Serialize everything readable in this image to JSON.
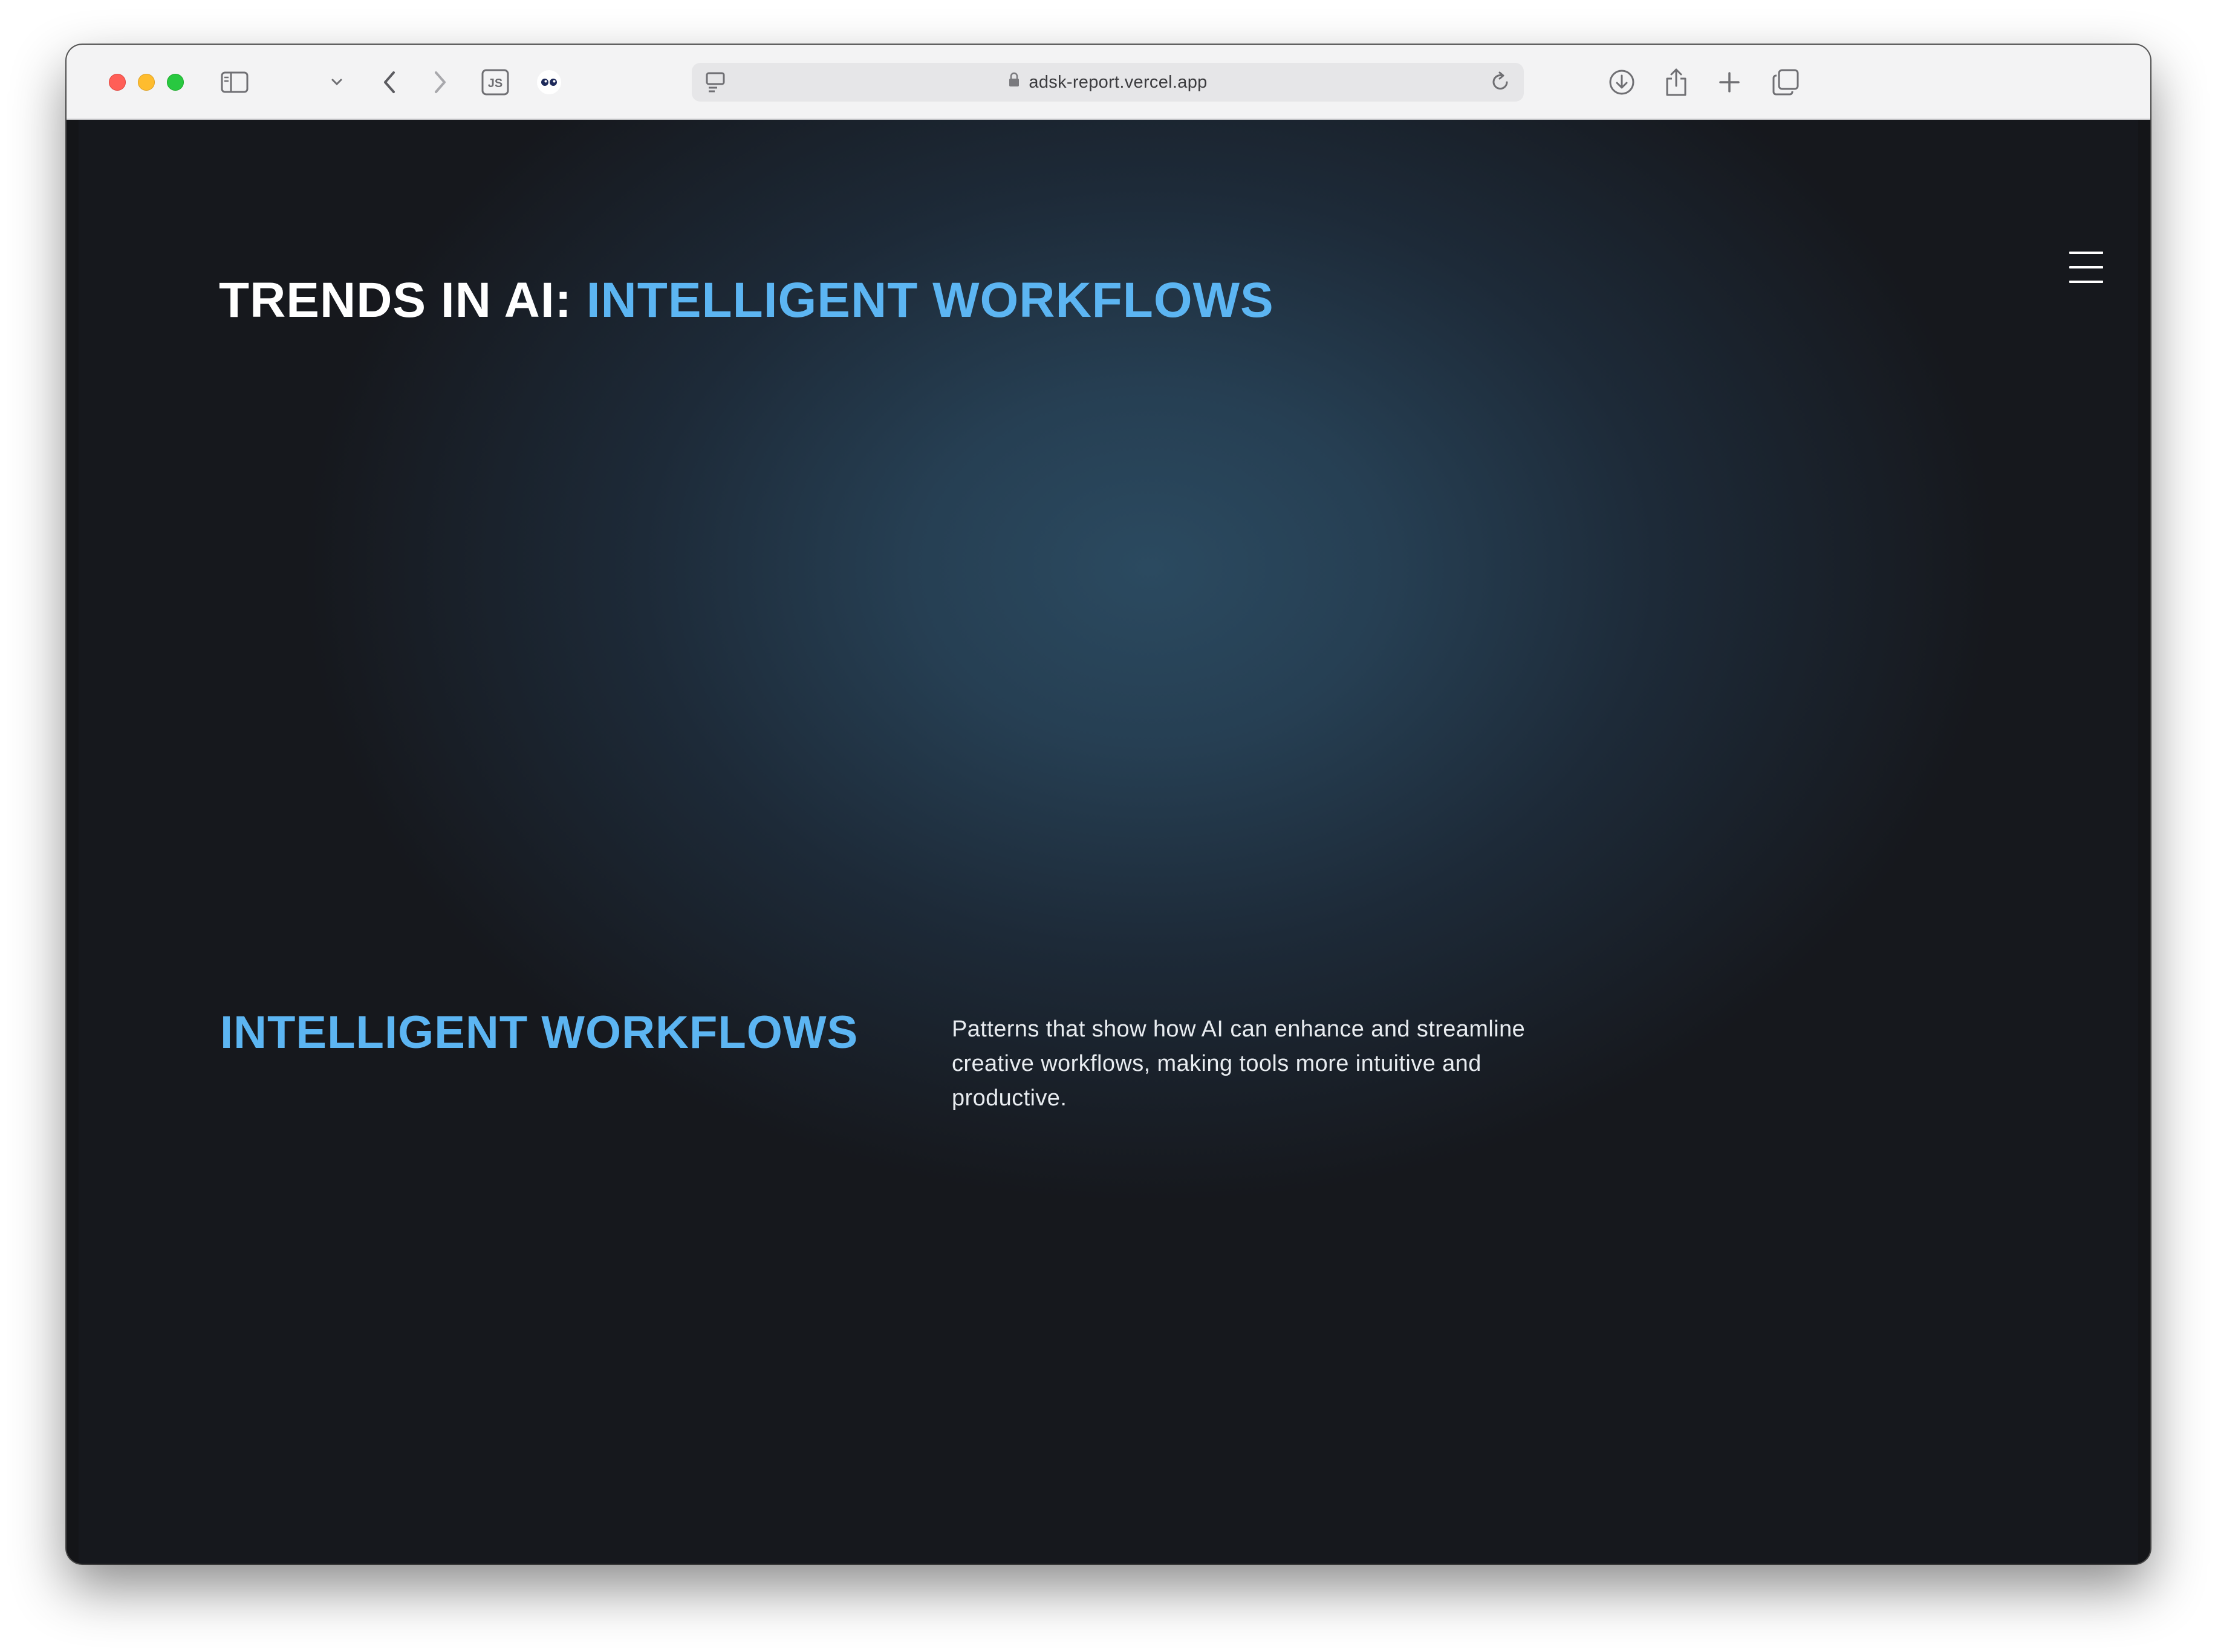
{
  "browser": {
    "url": "adsk-report.vercel.app",
    "extension_js_label": "JS",
    "icons": {
      "sidebar": "sidebar-toggle-icon",
      "chevron": "chevron-down-icon",
      "back": "back-arrow-icon",
      "forward": "forward-arrow-icon",
      "extension_js": "js-extension-icon",
      "extension_eyes": "eyes-extension-icon",
      "cloud": "cloud-icon",
      "page_menu": "page-menu-icon",
      "lock": "lock-icon",
      "reload": "reload-icon",
      "download": "download-icon",
      "share": "share-icon",
      "new_tab": "plus-icon",
      "tabs": "tab-overview-icon"
    }
  },
  "page": {
    "hero_title_white": "TRENDS IN AI:",
    "hero_title_blue": "INTELLIGENT WORKFLOWS",
    "section_title": "INTELLIGENT WORKFLOWS",
    "section_description": "Patterns that show how AI can enhance and streamline creative workflows, making tools more intuitive and productive.",
    "menu_icon": "hamburger-menu-icon"
  },
  "colors": {
    "accent_blue": "#5cb5f2",
    "background_dark": "#16181d",
    "background_glow": "#2b4a60"
  }
}
